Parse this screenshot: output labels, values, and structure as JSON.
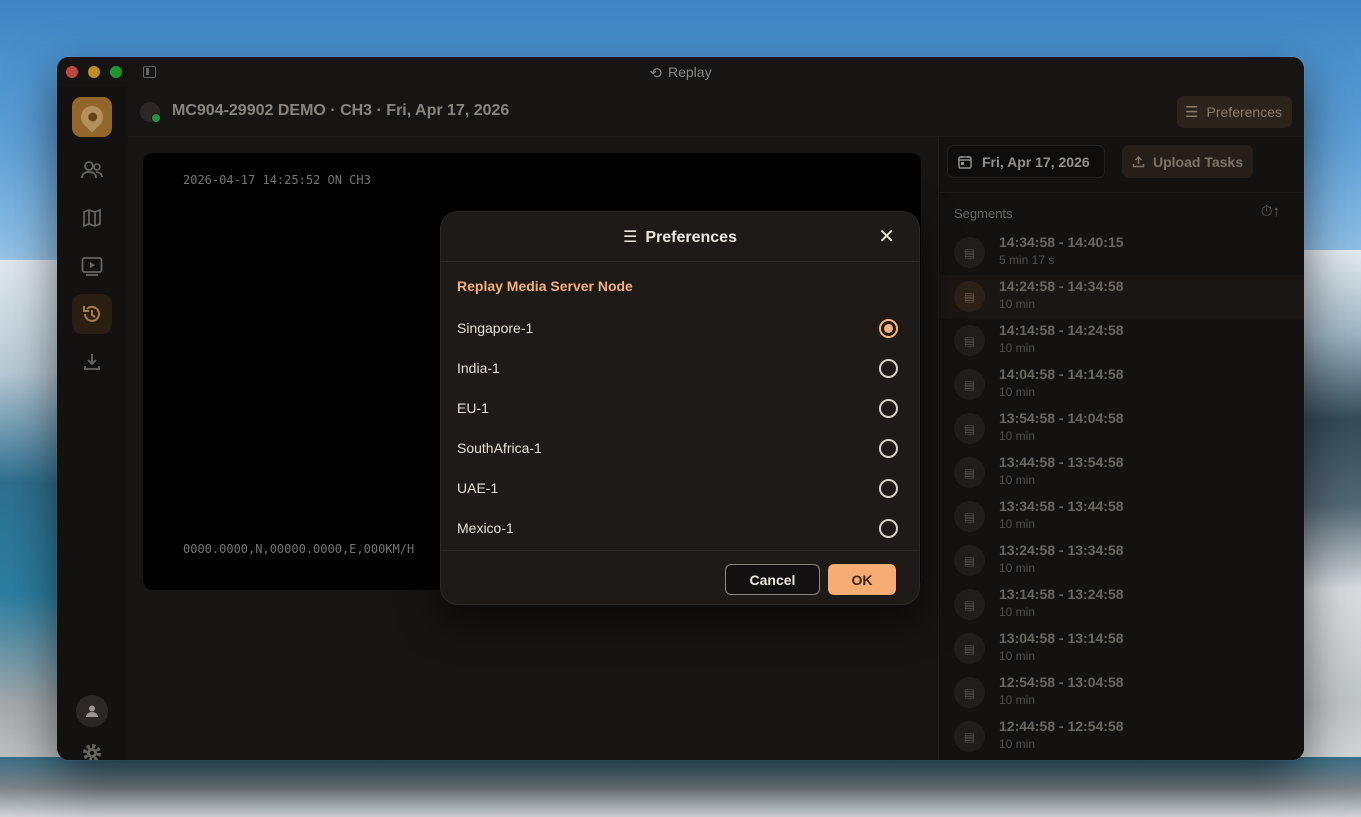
{
  "window": {
    "title": "Replay"
  },
  "header": {
    "title": "MC904-29902 DEMO · CH3 · Fri, Apr 17, 2026",
    "preferences_label": "Preferences"
  },
  "video": {
    "osd_top": "2026-04-17 14:25:52 ON  CH3",
    "osd_bottom": "0000.0000,N,00000.0000,E,000KM/H"
  },
  "right_panel": {
    "date_label": "Fri, Apr 17, 2026",
    "upload_label": "Upload Tasks",
    "segments_heading": "Segments",
    "segments": [
      {
        "time": "14:34:58 - 14:40:15",
        "duration": "5 min 17 s"
      },
      {
        "time": "14:24:58 - 14:34:58",
        "duration": "10 min"
      },
      {
        "time": "14:14:58 - 14:24:58",
        "duration": "10 min"
      },
      {
        "time": "14:04:58 - 14:14:58",
        "duration": "10 min"
      },
      {
        "time": "13:54:58 - 14:04:58",
        "duration": "10 min"
      },
      {
        "time": "13:44:58 - 13:54:58",
        "duration": "10 min"
      },
      {
        "time": "13:34:58 - 13:44:58",
        "duration": "10 min"
      },
      {
        "time": "13:24:58 - 13:34:58",
        "duration": "10 min"
      },
      {
        "time": "13:14:58 - 13:24:58",
        "duration": "10 min"
      },
      {
        "time": "13:04:58 - 13:14:58",
        "duration": "10 min"
      },
      {
        "time": "12:54:58 - 13:04:58",
        "duration": "10 min"
      },
      {
        "time": "12:44:58 - 12:54:58",
        "duration": "10 min"
      }
    ]
  },
  "dialog": {
    "title": "Preferences",
    "section": "Replay Media Server Node",
    "options": [
      "Singapore-1",
      "India-1",
      "EU-1",
      "SouthAfrica-1",
      "UAE-1",
      "Mexico-1"
    ],
    "selected": "Singapore-1",
    "cancel_label": "Cancel",
    "ok_label": "OK"
  },
  "colors": {
    "accent": "#f7ac74",
    "section": "#f2b07a",
    "background": "#1c1a18"
  }
}
